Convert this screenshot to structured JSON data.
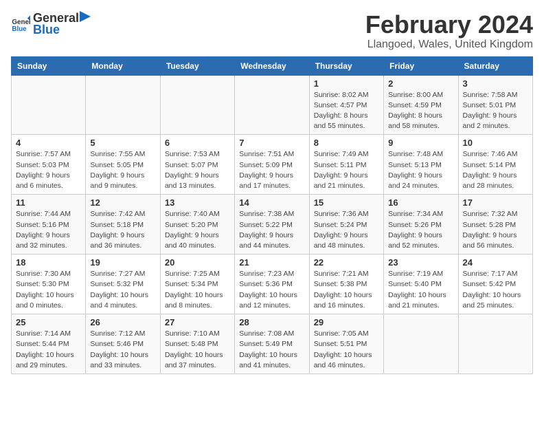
{
  "header": {
    "logo_general": "General",
    "logo_blue": "Blue",
    "title": "February 2024",
    "subtitle": "Llangoed, Wales, United Kingdom"
  },
  "days_of_week": [
    "Sunday",
    "Monday",
    "Tuesday",
    "Wednesday",
    "Thursday",
    "Friday",
    "Saturday"
  ],
  "weeks": [
    [
      {
        "day": "",
        "content": ""
      },
      {
        "day": "",
        "content": ""
      },
      {
        "day": "",
        "content": ""
      },
      {
        "day": "",
        "content": ""
      },
      {
        "day": "1",
        "content": "Sunrise: 8:02 AM\nSunset: 4:57 PM\nDaylight: 8 hours\nand 55 minutes."
      },
      {
        "day": "2",
        "content": "Sunrise: 8:00 AM\nSunset: 4:59 PM\nDaylight: 8 hours\nand 58 minutes."
      },
      {
        "day": "3",
        "content": "Sunrise: 7:58 AM\nSunset: 5:01 PM\nDaylight: 9 hours\nand 2 minutes."
      }
    ],
    [
      {
        "day": "4",
        "content": "Sunrise: 7:57 AM\nSunset: 5:03 PM\nDaylight: 9 hours\nand 6 minutes."
      },
      {
        "day": "5",
        "content": "Sunrise: 7:55 AM\nSunset: 5:05 PM\nDaylight: 9 hours\nand 9 minutes."
      },
      {
        "day": "6",
        "content": "Sunrise: 7:53 AM\nSunset: 5:07 PM\nDaylight: 9 hours\nand 13 minutes."
      },
      {
        "day": "7",
        "content": "Sunrise: 7:51 AM\nSunset: 5:09 PM\nDaylight: 9 hours\nand 17 minutes."
      },
      {
        "day": "8",
        "content": "Sunrise: 7:49 AM\nSunset: 5:11 PM\nDaylight: 9 hours\nand 21 minutes."
      },
      {
        "day": "9",
        "content": "Sunrise: 7:48 AM\nSunset: 5:13 PM\nDaylight: 9 hours\nand 24 minutes."
      },
      {
        "day": "10",
        "content": "Sunrise: 7:46 AM\nSunset: 5:14 PM\nDaylight: 9 hours\nand 28 minutes."
      }
    ],
    [
      {
        "day": "11",
        "content": "Sunrise: 7:44 AM\nSunset: 5:16 PM\nDaylight: 9 hours\nand 32 minutes."
      },
      {
        "day": "12",
        "content": "Sunrise: 7:42 AM\nSunset: 5:18 PM\nDaylight: 9 hours\nand 36 minutes."
      },
      {
        "day": "13",
        "content": "Sunrise: 7:40 AM\nSunset: 5:20 PM\nDaylight: 9 hours\nand 40 minutes."
      },
      {
        "day": "14",
        "content": "Sunrise: 7:38 AM\nSunset: 5:22 PM\nDaylight: 9 hours\nand 44 minutes."
      },
      {
        "day": "15",
        "content": "Sunrise: 7:36 AM\nSunset: 5:24 PM\nDaylight: 9 hours\nand 48 minutes."
      },
      {
        "day": "16",
        "content": "Sunrise: 7:34 AM\nSunset: 5:26 PM\nDaylight: 9 hours\nand 52 minutes."
      },
      {
        "day": "17",
        "content": "Sunrise: 7:32 AM\nSunset: 5:28 PM\nDaylight: 9 hours\nand 56 minutes."
      }
    ],
    [
      {
        "day": "18",
        "content": "Sunrise: 7:30 AM\nSunset: 5:30 PM\nDaylight: 10 hours\nand 0 minutes."
      },
      {
        "day": "19",
        "content": "Sunrise: 7:27 AM\nSunset: 5:32 PM\nDaylight: 10 hours\nand 4 minutes."
      },
      {
        "day": "20",
        "content": "Sunrise: 7:25 AM\nSunset: 5:34 PM\nDaylight: 10 hours\nand 8 minutes."
      },
      {
        "day": "21",
        "content": "Sunrise: 7:23 AM\nSunset: 5:36 PM\nDaylight: 10 hours\nand 12 minutes."
      },
      {
        "day": "22",
        "content": "Sunrise: 7:21 AM\nSunset: 5:38 PM\nDaylight: 10 hours\nand 16 minutes."
      },
      {
        "day": "23",
        "content": "Sunrise: 7:19 AM\nSunset: 5:40 PM\nDaylight: 10 hours\nand 21 minutes."
      },
      {
        "day": "24",
        "content": "Sunrise: 7:17 AM\nSunset: 5:42 PM\nDaylight: 10 hours\nand 25 minutes."
      }
    ],
    [
      {
        "day": "25",
        "content": "Sunrise: 7:14 AM\nSunset: 5:44 PM\nDaylight: 10 hours\nand 29 minutes."
      },
      {
        "day": "26",
        "content": "Sunrise: 7:12 AM\nSunset: 5:46 PM\nDaylight: 10 hours\nand 33 minutes."
      },
      {
        "day": "27",
        "content": "Sunrise: 7:10 AM\nSunset: 5:48 PM\nDaylight: 10 hours\nand 37 minutes."
      },
      {
        "day": "28",
        "content": "Sunrise: 7:08 AM\nSunset: 5:49 PM\nDaylight: 10 hours\nand 41 minutes."
      },
      {
        "day": "29",
        "content": "Sunrise: 7:05 AM\nSunset: 5:51 PM\nDaylight: 10 hours\nand 46 minutes."
      },
      {
        "day": "",
        "content": ""
      },
      {
        "day": "",
        "content": ""
      }
    ]
  ]
}
